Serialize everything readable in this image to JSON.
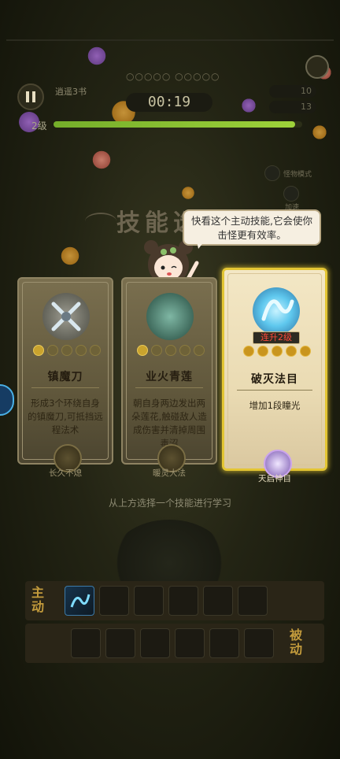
{
  "hud": {
    "level_name": "逍遥3书",
    "progress_dots": "○○○○○ ○○○○○",
    "timer": "00:19",
    "stat_top": "10",
    "stat_bottom": "13",
    "level": "2级",
    "xp_fraction": 0.97,
    "side_label_1": "怪物模式",
    "side_label_2": "加速"
  },
  "title": "技能选择",
  "speech_bubble": "快看这个主动技能,它会使你击怪更有效率。",
  "cards": [
    {
      "name": "镇魔刀",
      "stars_on": 1,
      "stars_total": 5,
      "description": "形成3个环绕自身的镇魔刀,可抵挡远程法术",
      "badge_label": "长久不熄",
      "icon": "crossed-blades-icon",
      "selected": false
    },
    {
      "name": "业火青莲",
      "stars_on": 1,
      "stars_total": 5,
      "description": "朝自身两边发出两朵莲花,触碰敌人造成伤害并清掉周围毒沼",
      "badge_label": "暖灵大法",
      "icon": "lotus-icon",
      "selected": false
    },
    {
      "name": "破灭法目",
      "stars_on": 2,
      "stars_total": 5,
      "upgrade_label": "连升2级",
      "description": "增加1段瞳光",
      "badge_label": "天启神目",
      "icon": "blue-spirit-icon",
      "selected": true
    }
  ],
  "hint": "从上方选择一个技能进行学习",
  "skill_bars": {
    "active_label": "主动",
    "passive_label": "被动",
    "active_slots": 6,
    "passive_slots": 6
  },
  "colors": {
    "select_border": "#e3c533",
    "xp_bar": "#8ac634",
    "upgrade_text": "#ff4a3a"
  }
}
